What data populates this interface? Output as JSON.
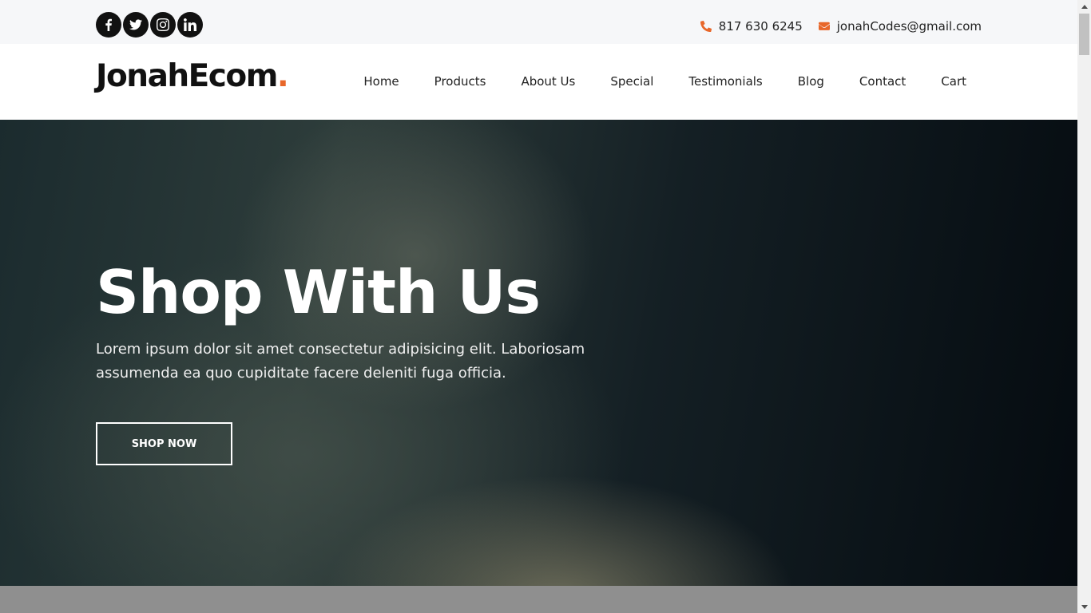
{
  "topbar": {
    "social": [
      {
        "icon": "facebook-icon"
      },
      {
        "icon": "twitter-icon"
      },
      {
        "icon": "instagram-icon"
      },
      {
        "icon": "linkedin-icon"
      }
    ],
    "phone": "817 630 6245",
    "email": "jonahCodes@gmail.com",
    "accent_color": "#e8672a"
  },
  "header": {
    "logo_text": "JonahEcom",
    "logo_dot": ".",
    "nav": [
      "Home",
      "Products",
      "About Us",
      "Special",
      "Testimonials",
      "Blog",
      "Contact",
      "Cart"
    ]
  },
  "hero": {
    "title": "Shop With Us",
    "subtitle": "Lorem ipsum dolor sit amet consectetur adipisicing elit. Laboriosam assumenda ea quo cupiditate facere deleniti fuga officia.",
    "button_label": "SHOP NOW"
  }
}
